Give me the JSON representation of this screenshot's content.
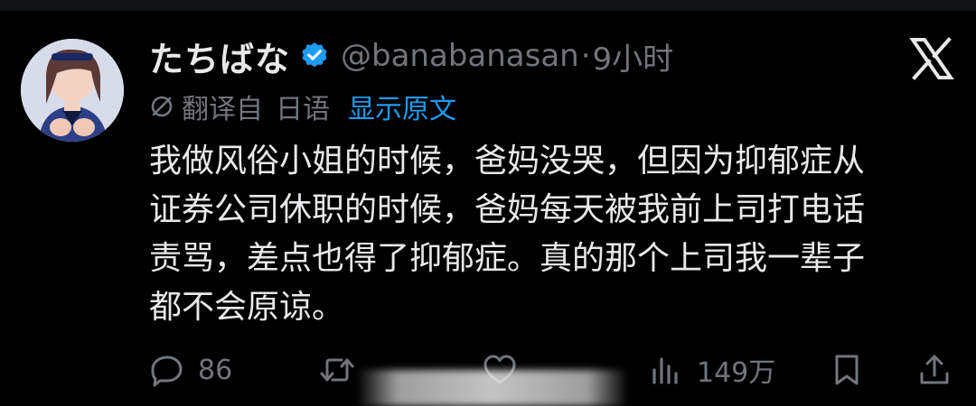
{
  "tweet": {
    "display_name": "たちばな",
    "handle": "@banabanasan",
    "separator": "·",
    "time": "9小时",
    "translation": {
      "label": "翻译自",
      "language": "日语",
      "show_original": "显示原文"
    },
    "body_lines": [
      "我做风俗小姐的时候，爸妈没哭，但因为抑郁症从",
      "证券公司休职的时候，爸妈每天被我前上司打电话",
      "责骂，差点也得了抑郁症。真的那个上司我一辈子",
      "都不会原谅。"
    ],
    "actions": {
      "replies": "86",
      "reposts": "",
      "likes": "",
      "views": "149万"
    }
  },
  "icons": {
    "verified": "verified-badge-icon",
    "x_logo": "x-logo-icon",
    "translate": "translate-globe-icon",
    "reply": "reply-icon",
    "repost": "repost-icon",
    "like": "like-icon",
    "views": "views-icon",
    "bookmark": "bookmark-icon",
    "share": "share-icon"
  },
  "colors": {
    "background": "#000000",
    "primary_text": "#e7e9ea",
    "secondary_text": "#71767b",
    "accent": "#1d9bf0"
  }
}
